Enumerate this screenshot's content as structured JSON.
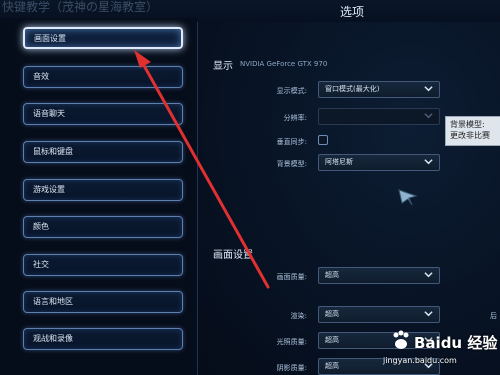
{
  "watermark_top": "快键教学（茂神の星海教室）",
  "window": {
    "title": "选项"
  },
  "sidebar": {
    "items": [
      {
        "label": "画面设置",
        "active": true
      },
      {
        "label": "音效"
      },
      {
        "label": "语音聊天"
      },
      {
        "label": "鼠标和键盘"
      },
      {
        "label": "游戏设置"
      },
      {
        "label": "颜色"
      },
      {
        "label": "社交"
      },
      {
        "label": "语言和地区"
      },
      {
        "label": "观战和录像"
      }
    ]
  },
  "display": {
    "title": "显示",
    "gpu": "NVIDIA GeForce GTX 970",
    "display_mode_label": "显示模式:",
    "display_mode_value": "窗口模式(最大化)",
    "resolution_label": "分辨率:",
    "resolution_value": "",
    "vsync_label": "垂直同步:",
    "vsync_checked": false,
    "background_model_label": "背景模型:",
    "background_model_value": "阿塔尼斯"
  },
  "tooltip": {
    "title": "背景模型:",
    "text": "更改非比赛"
  },
  "graphics": {
    "title": "画面设置",
    "quality_label": "画面质量:",
    "quality_value": "超高",
    "render_label": "渲染:",
    "render_value": "超高",
    "lighting_label": "光照质量:",
    "lighting_value": "超高",
    "shadow_label": "阴影质量:",
    "shadow_value": "超高",
    "right_edge_label": "后"
  },
  "baidu_watermark": {
    "brand": "Baidu 经验",
    "url": "jingyan.baidu.com"
  },
  "colors": {
    "accent": "#5c7fae",
    "active_border": "#dfeaff",
    "arrow": "#e03030"
  }
}
